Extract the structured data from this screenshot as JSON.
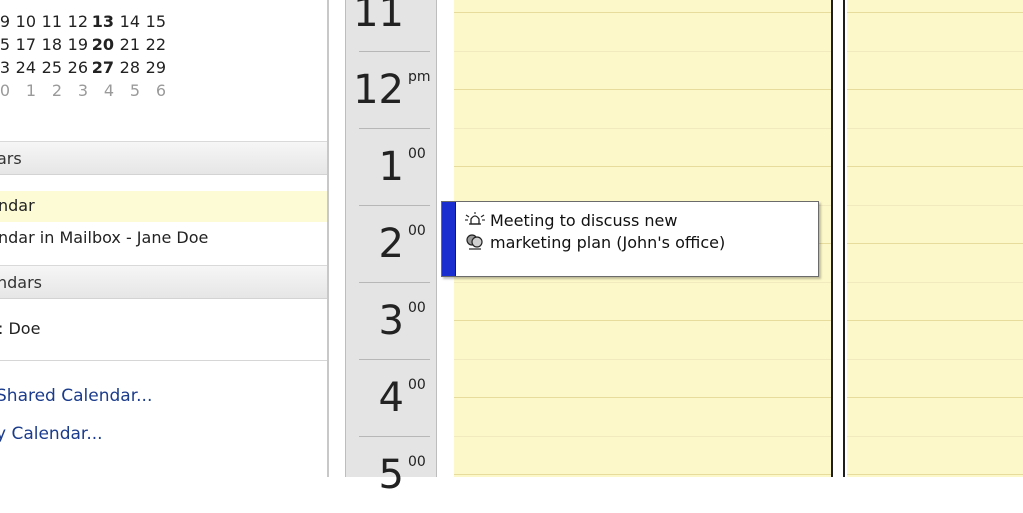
{
  "mini_calendar": {
    "rows": [
      {
        "days": [
          "9",
          "10",
          "11",
          "12",
          "13",
          "14",
          "15"
        ],
        "bold_index": 4
      },
      {
        "days": [
          "5",
          "17",
          "18",
          "19",
          "20",
          "21",
          "22"
        ],
        "bold_index": 4
      },
      {
        "days": [
          "3",
          "24",
          "25",
          "26",
          "27",
          "28",
          "29"
        ],
        "bold_index": 4
      },
      {
        "days": [
          "0",
          "1",
          "2",
          "3",
          "4",
          "5",
          "6"
        ],
        "bold_index": -1
      }
    ]
  },
  "sidebar": {
    "section_my_calendars": "ars",
    "my_calendars": [
      {
        "label": "ndar",
        "selected": true
      },
      {
        "label": "ndar in Mailbox - Jane Doe",
        "selected": false
      }
    ],
    "section_other_calendars": "ndars",
    "other_calendars": [
      {
        "label": ": Doe"
      }
    ],
    "link_shared": "Shared Calendar...",
    "link_my": "y Calendar..."
  },
  "time_column": {
    "slots": [
      {
        "hour": "11",
        "sup": ""
      },
      {
        "hour": "12",
        "sup": "pm"
      },
      {
        "hour": "1",
        "sup": "00"
      },
      {
        "hour": "2",
        "sup": "00"
      },
      {
        "hour": "3",
        "sup": "00"
      },
      {
        "hour": "4",
        "sup": "00"
      },
      {
        "hour": "5",
        "sup": "00"
      }
    ]
  },
  "appointment": {
    "line1": "Meeting to discuss new",
    "line2": "marketing plan (John's office)",
    "reminder_icon": "reminder-bell-icon",
    "recurrence_icon": "meeting-attendees-icon",
    "busy_color": "#1a2ed0"
  },
  "colors": {
    "day_background": "#fdf8c9",
    "time_column_background": "#e4e4e4",
    "link": "#1b3c8c"
  }
}
